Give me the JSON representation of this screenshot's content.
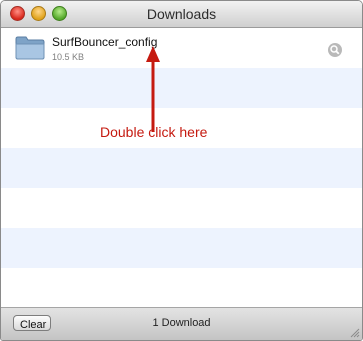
{
  "window": {
    "title": "Downloads"
  },
  "downloads": [
    {
      "name": "SurfBouncer_config",
      "size": "10.5 KB",
      "icon": "folder-icon"
    }
  ],
  "annotation": {
    "text": "Double click here",
    "color": "#c51a10"
  },
  "footer": {
    "clear_label": "Clear",
    "status": "1 Download"
  },
  "colors": {
    "stripe": "#edf3fe",
    "titlebar": "#d9d9d9"
  }
}
